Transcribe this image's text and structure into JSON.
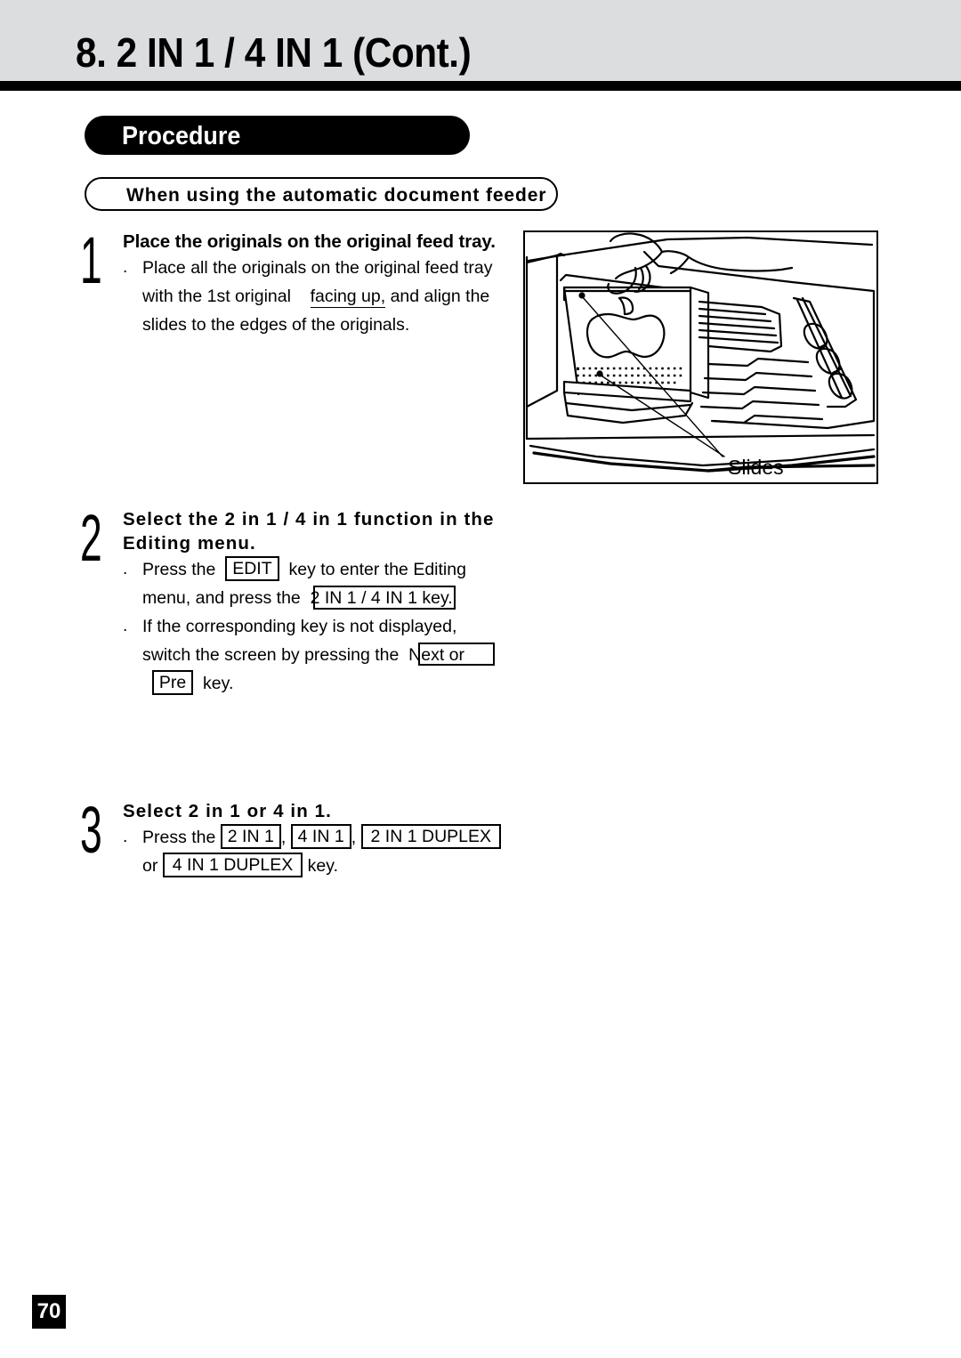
{
  "header": {
    "title": "8. 2 IN 1 / 4 IN 1 (Cont.)"
  },
  "procedure": {
    "banner_label": "Procedure",
    "subheading": "When using the automatic document feeder"
  },
  "steps": [
    {
      "number": "1",
      "title": "Place the originals on the original feed tray.",
      "bullet_marker": ".",
      "lines": [
        "Place all the originals on the original feed tray",
        "with the 1st original",
        "facing up,",
        "and align the",
        "slides  to  the  edges  of  the  originals."
      ]
    },
    {
      "number": "2",
      "title_line1": "Select  the  2 in 1 /  4 in 1 function  in  the",
      "title_line2": "Editing  menu.",
      "bullet1": {
        "marker": ".",
        "pre": "Press  the",
        "key1": "EDIT",
        "mid": "key  to  enter  the  Editing",
        "line2_pre": "menu,  and  press  the",
        "key2": "2 IN 1 / 4 IN 1",
        "line2_post": "key."
      },
      "bullet2": {
        "marker": ".",
        "line1": "If  the  corresponding  key  is  not  displayed,",
        "line2_pre": "switch  the  screen  by  pressing  the",
        "key3": "Next  or",
        "key4": "Pre",
        "line3_post": "key."
      }
    },
    {
      "number": "3",
      "title": "Select  2 in 1 or 4 in 1.",
      "bullet": {
        "marker": ".",
        "pre": "Press the",
        "key1": "2 IN 1",
        "sep1": ",",
        "key2": "4 IN 1",
        "sep2": ",",
        "key3": "2 IN 1 DUPLEX",
        "line2_pre": "or",
        "key4": "4 IN 1  DUPLEX",
        "line2_post": "key."
      }
    }
  ],
  "illustration": {
    "caption": "Slides",
    "alt_name": "document-feeder-loading-illustration"
  },
  "footer": {
    "page_number": "70"
  },
  "colors": {
    "header_band": "#dcdddf",
    "rule": "#000000",
    "banner": "#000000",
    "page_background": "#ffffff"
  }
}
